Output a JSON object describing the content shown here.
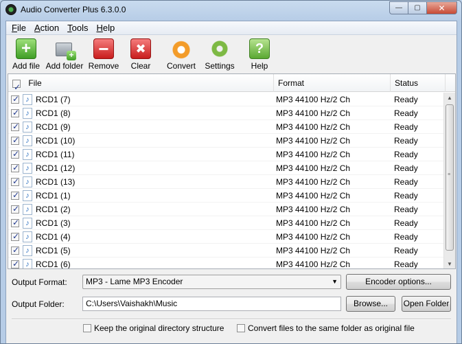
{
  "window": {
    "title": "Audio Converter Plus 6.3.0.0",
    "min_glyph": "—",
    "max_glyph": "▢",
    "close_glyph": "✕"
  },
  "menu": [
    {
      "label": "File",
      "mnemonic": "F"
    },
    {
      "label": "Action",
      "mnemonic": "A"
    },
    {
      "label": "Tools",
      "mnemonic": "T"
    },
    {
      "label": "Help",
      "mnemonic": "H"
    }
  ],
  "toolbar": {
    "add_file": "Add file",
    "add_folder": "Add folder",
    "remove": "Remove",
    "clear": "Clear",
    "convert": "Convert",
    "settings": "Settings",
    "help": "Help"
  },
  "list": {
    "columns": {
      "file": "File",
      "format": "Format",
      "status": "Status"
    },
    "rows": [
      {
        "name": "RCD1 (7)",
        "format": "MP3 44100 Hz/2 Ch",
        "status": "Ready"
      },
      {
        "name": "RCD1 (8)",
        "format": "MP3 44100 Hz/2 Ch",
        "status": "Ready"
      },
      {
        "name": "RCD1 (9)",
        "format": "MP3 44100 Hz/2 Ch",
        "status": "Ready"
      },
      {
        "name": "RCD1 (10)",
        "format": "MP3 44100 Hz/2 Ch",
        "status": "Ready"
      },
      {
        "name": "RCD1 (11)",
        "format": "MP3 44100 Hz/2 Ch",
        "status": "Ready"
      },
      {
        "name": "RCD1 (12)",
        "format": "MP3 44100 Hz/2 Ch",
        "status": "Ready"
      },
      {
        "name": "RCD1 (13)",
        "format": "MP3 44100 Hz/2 Ch",
        "status": "Ready"
      },
      {
        "name": "RCD1 (1)",
        "format": "MP3 44100 Hz/2 Ch",
        "status": "Ready"
      },
      {
        "name": "RCD1 (2)",
        "format": "MP3 44100 Hz/2 Ch",
        "status": "Ready"
      },
      {
        "name": "RCD1 (3)",
        "format": "MP3 44100 Hz/2 Ch",
        "status": "Ready"
      },
      {
        "name": "RCD1 (4)",
        "format": "MP3 44100 Hz/2 Ch",
        "status": "Ready"
      },
      {
        "name": "RCD1 (5)",
        "format": "MP3 44100 Hz/2 Ch",
        "status": "Ready"
      },
      {
        "name": "RCD1 (6)",
        "format": "MP3 44100 Hz/2 Ch",
        "status": "Ready"
      }
    ]
  },
  "output": {
    "format_label": "Output Format:",
    "format_value": "MP3  - Lame MP3 Encoder",
    "encoder_options": "Encoder options...",
    "folder_label": "Output Folder:",
    "folder_value": "C:\\Users\\Vaishakh\\Music",
    "browse": "Browse...",
    "open_folder": "Open Folder",
    "keep_structure": "Keep the original directory structure",
    "same_folder": "Convert files to the same folder as original file"
  }
}
